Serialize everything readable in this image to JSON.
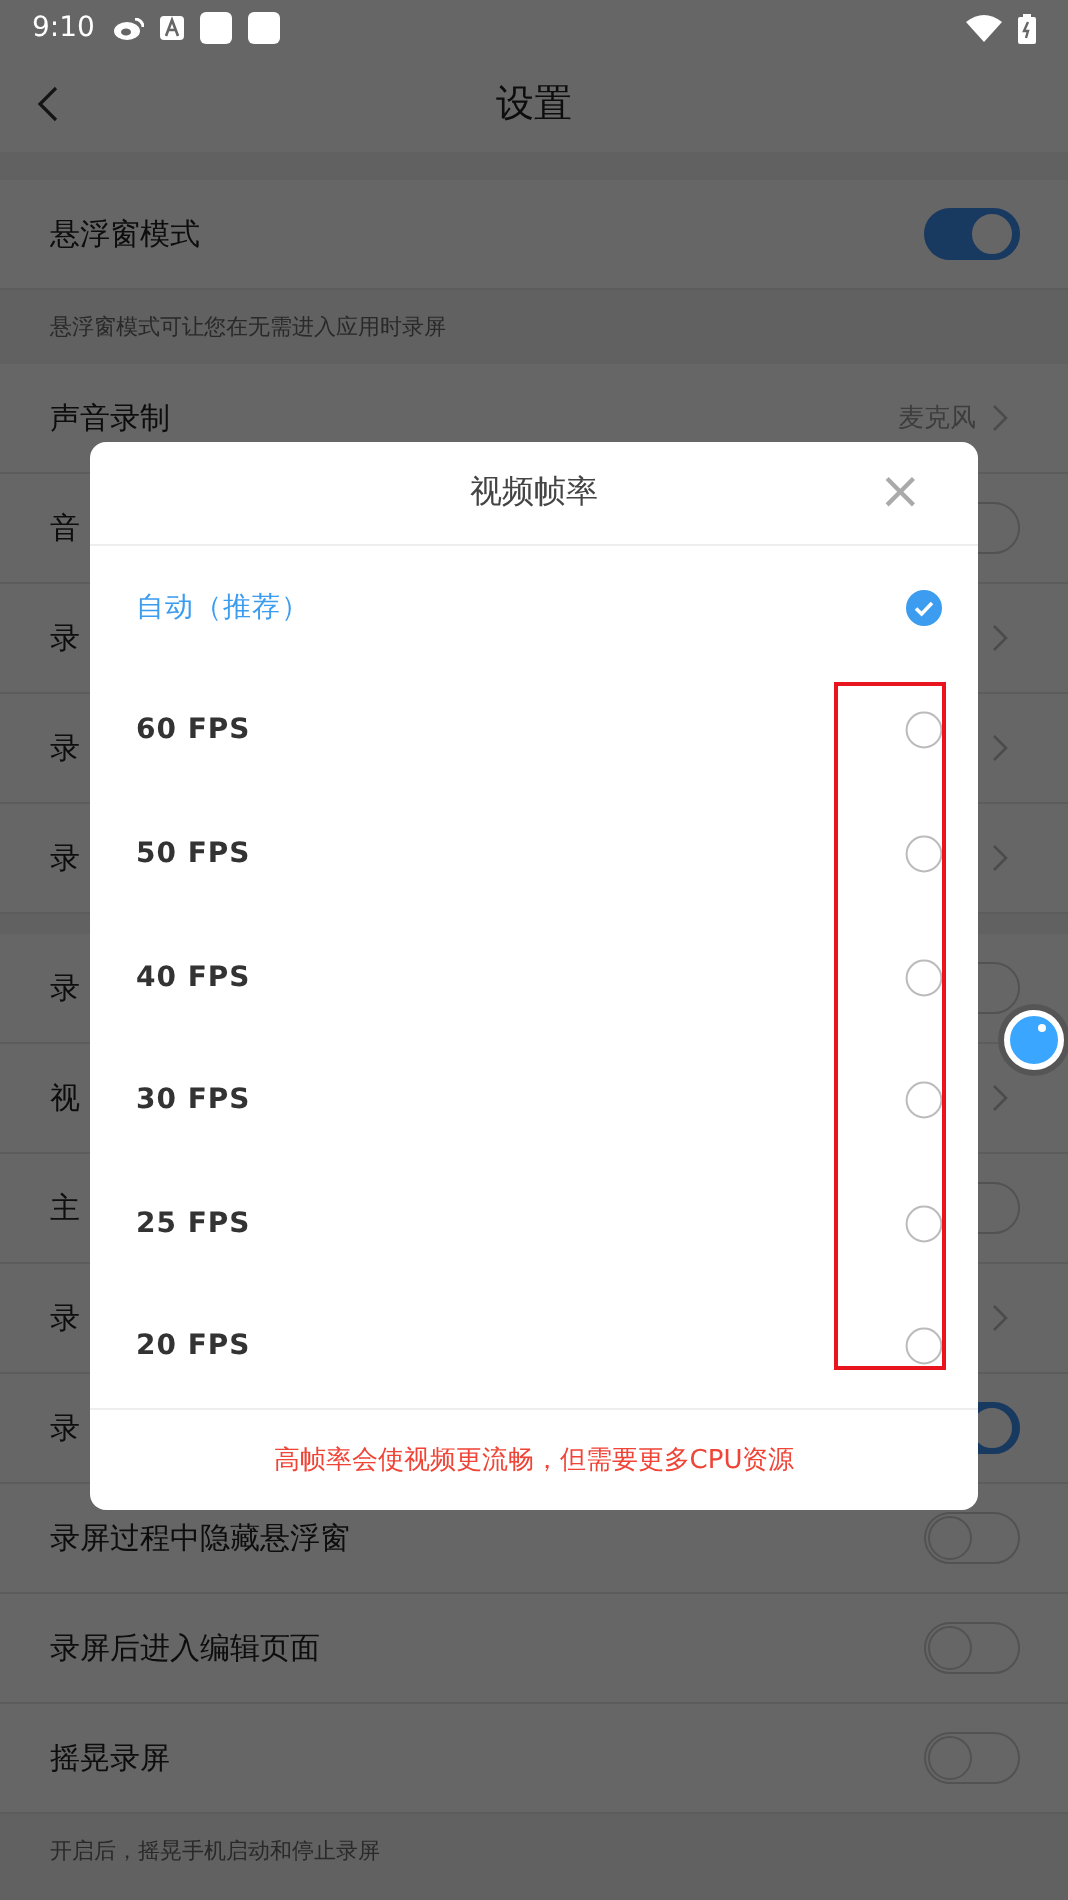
{
  "status_bar": {
    "time": "9:10"
  },
  "header": {
    "title": "设置"
  },
  "sections": [
    {
      "rows": [
        {
          "kind": "toggle",
          "label": "悬浮窗模式",
          "on": true
        }
      ],
      "hint": "悬浮窗模式可让您在无需进入应用时录屏"
    },
    {
      "rows": [
        {
          "kind": "link",
          "label": "声音录制",
          "value": "麦克风"
        },
        {
          "kind": "toggle",
          "label": "音",
          "on": false
        },
        {
          "kind": "link",
          "label": "录"
        },
        {
          "kind": "link",
          "label": "录"
        },
        {
          "kind": "link",
          "label": "录"
        }
      ]
    },
    {
      "rows": [
        {
          "kind": "toggle",
          "label": "录",
          "on": false
        },
        {
          "kind": "link",
          "label": "视"
        },
        {
          "kind": "toggle",
          "label": "主",
          "on": false
        },
        {
          "kind": "link",
          "label": "录"
        },
        {
          "kind": "toggle",
          "label": "录",
          "on": true
        },
        {
          "kind": "toggle",
          "label": "录屏过程中隐藏悬浮窗",
          "on": false
        },
        {
          "kind": "toggle",
          "label": "录屏后进入编辑页面",
          "on": false
        },
        {
          "kind": "toggle",
          "label": "摇晃录屏",
          "on": false
        }
      ],
      "hint": "开启后，摇晃手机启动和停止录屏"
    }
  ],
  "dialog": {
    "title": "视频帧率",
    "close": "×",
    "options": [
      {
        "label": "自动（推荐）",
        "selected": true
      },
      {
        "label": "60 FPS",
        "selected": false
      },
      {
        "label": "50 FPS",
        "selected": false
      },
      {
        "label": "40 FPS",
        "selected": false
      },
      {
        "label": "30 FPS",
        "selected": false
      },
      {
        "label": "25 FPS",
        "selected": false
      },
      {
        "label": "20 FPS",
        "selected": false
      }
    ],
    "note": "高帧率会使视频更流畅，但需要更多CPU资源"
  }
}
